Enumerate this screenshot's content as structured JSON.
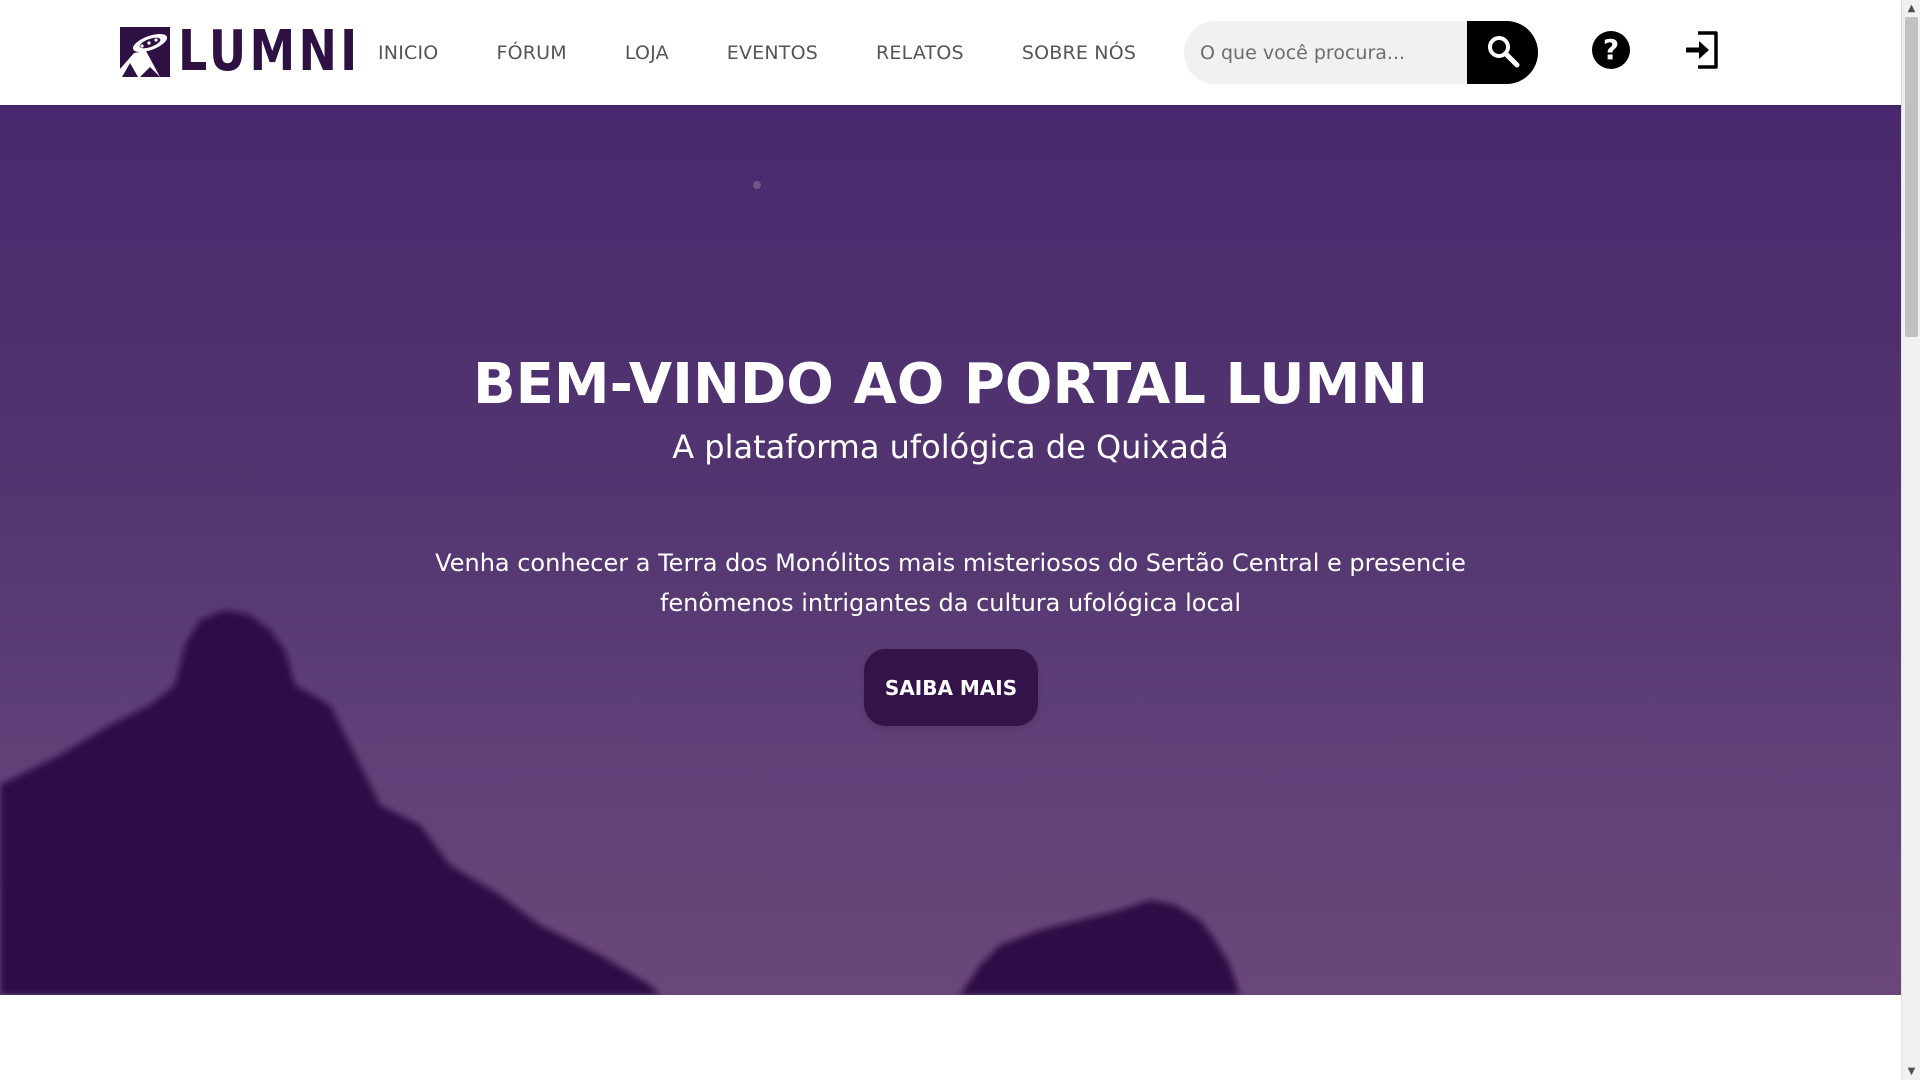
{
  "header": {
    "logo_text": "LUMNI",
    "nav": [
      {
        "label": "INICIO"
      },
      {
        "label": "FÓRUM"
      },
      {
        "label": "LOJA"
      },
      {
        "label": "EVENTOS"
      },
      {
        "label": "RELATOS"
      },
      {
        "label": "SOBRE NÓS"
      }
    ],
    "search": {
      "placeholder": "O que você procura...",
      "value": ""
    },
    "icons": {
      "search": "search-icon",
      "help": "question-circle-icon",
      "login": "login-icon"
    },
    "help_glyph": "?"
  },
  "hero": {
    "title": "BEM-VINDO AO PORTAL LUMNI",
    "subtitle": "A plataforma ufológica de Quixadá",
    "text": "Venha conhecer a Terra dos Monólitos mais misteriosos do Sertão Central e presencie fenômenos intrigantes da cultura ufológica local",
    "cta_label": "SAIBA MAIS"
  },
  "colors": {
    "brand_dark": "#2e1042",
    "hero_top": "#48296f",
    "hero_bottom": "#6a4779",
    "cta_background": "#33134a",
    "nav_text": "#555555"
  },
  "scrollbar": {
    "up_glyph": "▲",
    "down_glyph": "▼"
  }
}
